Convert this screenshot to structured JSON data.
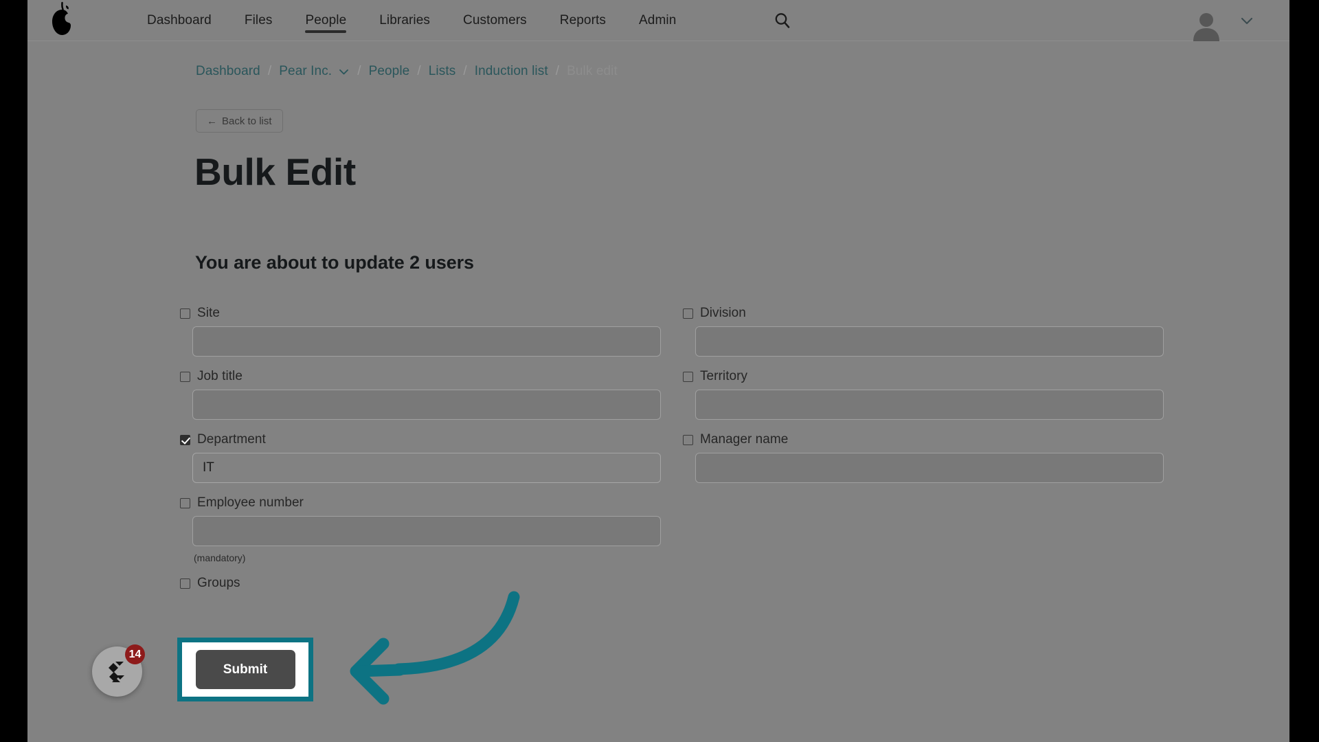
{
  "topnav": {
    "logo_icon": "pear-logo-icon",
    "items": [
      {
        "label": "Dashboard",
        "active": false
      },
      {
        "label": "Files",
        "active": false
      },
      {
        "label": "People",
        "active": true
      },
      {
        "label": "Libraries",
        "active": false
      },
      {
        "label": "Customers",
        "active": false
      },
      {
        "label": "Reports",
        "active": false
      },
      {
        "label": "Admin",
        "active": false
      }
    ],
    "search_icon": "search-icon",
    "avatar_icon": "user-avatar-icon",
    "caret_icon": "chevron-down-icon"
  },
  "breadcrumb": {
    "items": [
      {
        "label": "Dashboard",
        "current": false,
        "caret": false
      },
      {
        "label": "Pear Inc.",
        "current": false,
        "caret": true
      },
      {
        "label": "People",
        "current": false,
        "caret": false
      },
      {
        "label": "Lists",
        "current": false,
        "caret": false
      },
      {
        "label": "Induction list",
        "current": false,
        "caret": false
      },
      {
        "label": "Bulk edit",
        "current": true,
        "caret": false
      }
    ],
    "separator": "/"
  },
  "back_button": {
    "arrow": "←",
    "label": "Back to list"
  },
  "page_title": "Bulk Edit",
  "sub_title": "You are about to update 2 users",
  "form": {
    "rows": [
      {
        "left": {
          "label": "Site",
          "checked": false,
          "value": "",
          "hint": ""
        },
        "right": {
          "label": "Division",
          "checked": false,
          "value": "",
          "hint": ""
        }
      },
      {
        "left": {
          "label": "Job title",
          "checked": false,
          "value": "",
          "hint": ""
        },
        "right": {
          "label": "Territory",
          "checked": false,
          "value": "",
          "hint": ""
        }
      },
      {
        "left": {
          "label": "Department",
          "checked": true,
          "value": "IT",
          "hint": ""
        },
        "right": {
          "label": "Manager name",
          "checked": false,
          "value": "",
          "hint": ""
        }
      },
      {
        "left": {
          "label": "Employee number",
          "checked": false,
          "value": "",
          "hint": "(mandatory)"
        },
        "right": null
      },
      {
        "left": {
          "label": "Groups",
          "checked": false,
          "value": null,
          "hint": ""
        },
        "right": null
      }
    ]
  },
  "submit": {
    "label": "Submit"
  },
  "annotation": {
    "arrow_icon": "curved-left-arrow-annotation",
    "color": "#0d7383"
  },
  "help_widget": {
    "icon": "help-center-logo-icon",
    "badge_count": "14"
  },
  "colors": {
    "overlay_background": "#828282",
    "accent_teal": "#0d7383",
    "breadcrumb_link": "#2a565b",
    "badge_red": "#8e1b1b",
    "submit_button": "#4a4a4a"
  }
}
